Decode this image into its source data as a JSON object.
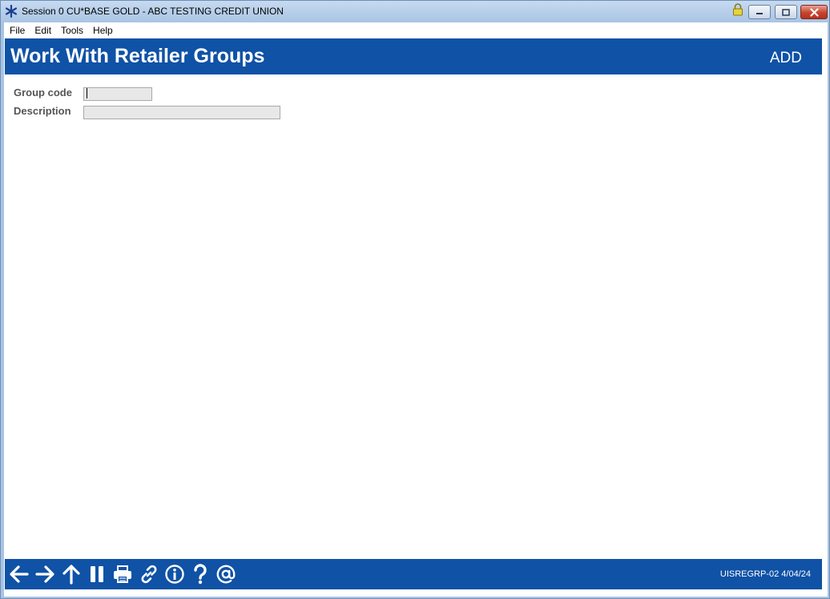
{
  "window": {
    "title": "Session 0 CU*BASE GOLD - ABC TESTING CREDIT UNION"
  },
  "menu": {
    "items": [
      "File",
      "Edit",
      "Tools",
      "Help"
    ]
  },
  "header": {
    "title": "Work With Retailer Groups",
    "mode": "ADD"
  },
  "form": {
    "group_code_label": "Group code",
    "group_code_value": "",
    "description_label": "Description",
    "description_value": ""
  },
  "footer": {
    "icons": [
      "back-arrow-icon",
      "forward-arrow-icon",
      "up-arrow-icon",
      "pause-icon",
      "print-icon",
      "link-icon",
      "info-icon",
      "help-icon",
      "email-icon"
    ],
    "screen_id": "UISREGRP-02 4/04/24"
  },
  "colors": {
    "brand_blue": "#0f52a6",
    "label_gray": "#555555",
    "input_bg": "#e8e8e8"
  }
}
